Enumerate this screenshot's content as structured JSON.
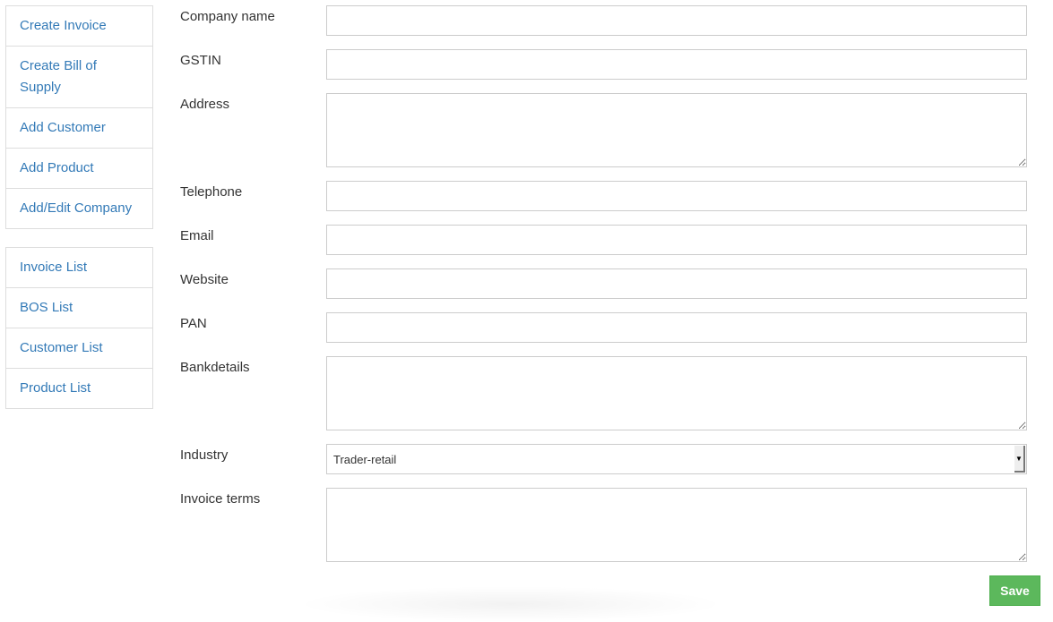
{
  "sidebar": {
    "group1": [
      {
        "label": "Create Invoice"
      },
      {
        "label": "Create Bill of Supply"
      },
      {
        "label": "Add Customer"
      },
      {
        "label": "Add Product"
      },
      {
        "label": "Add/Edit Company"
      }
    ],
    "group2": [
      {
        "label": "Invoice List"
      },
      {
        "label": "BOS List"
      },
      {
        "label": "Customer List"
      },
      {
        "label": "Product List"
      }
    ]
  },
  "form": {
    "company_name": {
      "label": "Company name",
      "value": ""
    },
    "gstin": {
      "label": "GSTIN",
      "value": ""
    },
    "address": {
      "label": "Address",
      "value": ""
    },
    "telephone": {
      "label": "Telephone",
      "value": ""
    },
    "email": {
      "label": "Email",
      "value": ""
    },
    "website": {
      "label": "Website",
      "value": ""
    },
    "pan": {
      "label": "PAN",
      "value": ""
    },
    "bankdetails": {
      "label": "Bankdetails",
      "value": ""
    },
    "industry": {
      "label": "Industry",
      "selected": "Trader-retail"
    },
    "invoice_terms": {
      "label": "Invoice terms",
      "value": ""
    }
  },
  "actions": {
    "save_label": "Save"
  },
  "colors": {
    "link": "#337ab7",
    "save": "#5cb85c"
  }
}
